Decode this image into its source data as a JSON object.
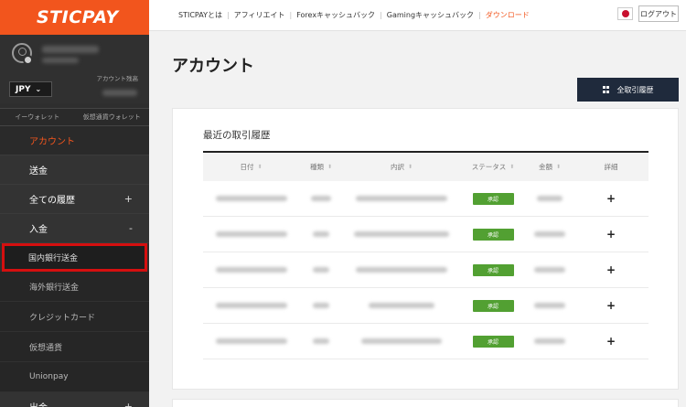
{
  "brand": {
    "logo_text": "STICPAY",
    "accent": "#f2551d"
  },
  "sidebar": {
    "currency": "JPY",
    "account_label": "アカウント残高",
    "wallet_tabs": [
      "イーウォレット",
      "仮想通貨ウォレット"
    ],
    "nav": [
      {
        "label": "アカウント",
        "sign": "",
        "active": true
      },
      {
        "label": "送金",
        "sign": ""
      },
      {
        "label": "全ての履歴",
        "sign": "+"
      },
      {
        "label": "入金",
        "sign": "-"
      }
    ],
    "sub": [
      "国内銀行送金",
      "海外銀行送金",
      "クレジットカード",
      "仮想通貨",
      "Unionpay"
    ],
    "nav_bottom": {
      "label": "出金",
      "sign": "+"
    }
  },
  "topbar": {
    "links": [
      "STICPAYとは",
      "アフィリエイト",
      "Forexキャッシュバック",
      "Gamingキャッシュバック",
      "ダウンロード"
    ],
    "logout": "ログアウト"
  },
  "main": {
    "title": "アカウント",
    "all_history_button": "全取引履歴",
    "card_title": "最近の取引履歴",
    "columns": [
      "日付",
      "種類",
      "内訳",
      "ステータス",
      "金額",
      "詳細"
    ],
    "rows": [
      {
        "status": "承認"
      },
      {
        "status": "承認"
      },
      {
        "status": "承認"
      },
      {
        "status": "承認"
      },
      {
        "status": "承認"
      }
    ]
  }
}
